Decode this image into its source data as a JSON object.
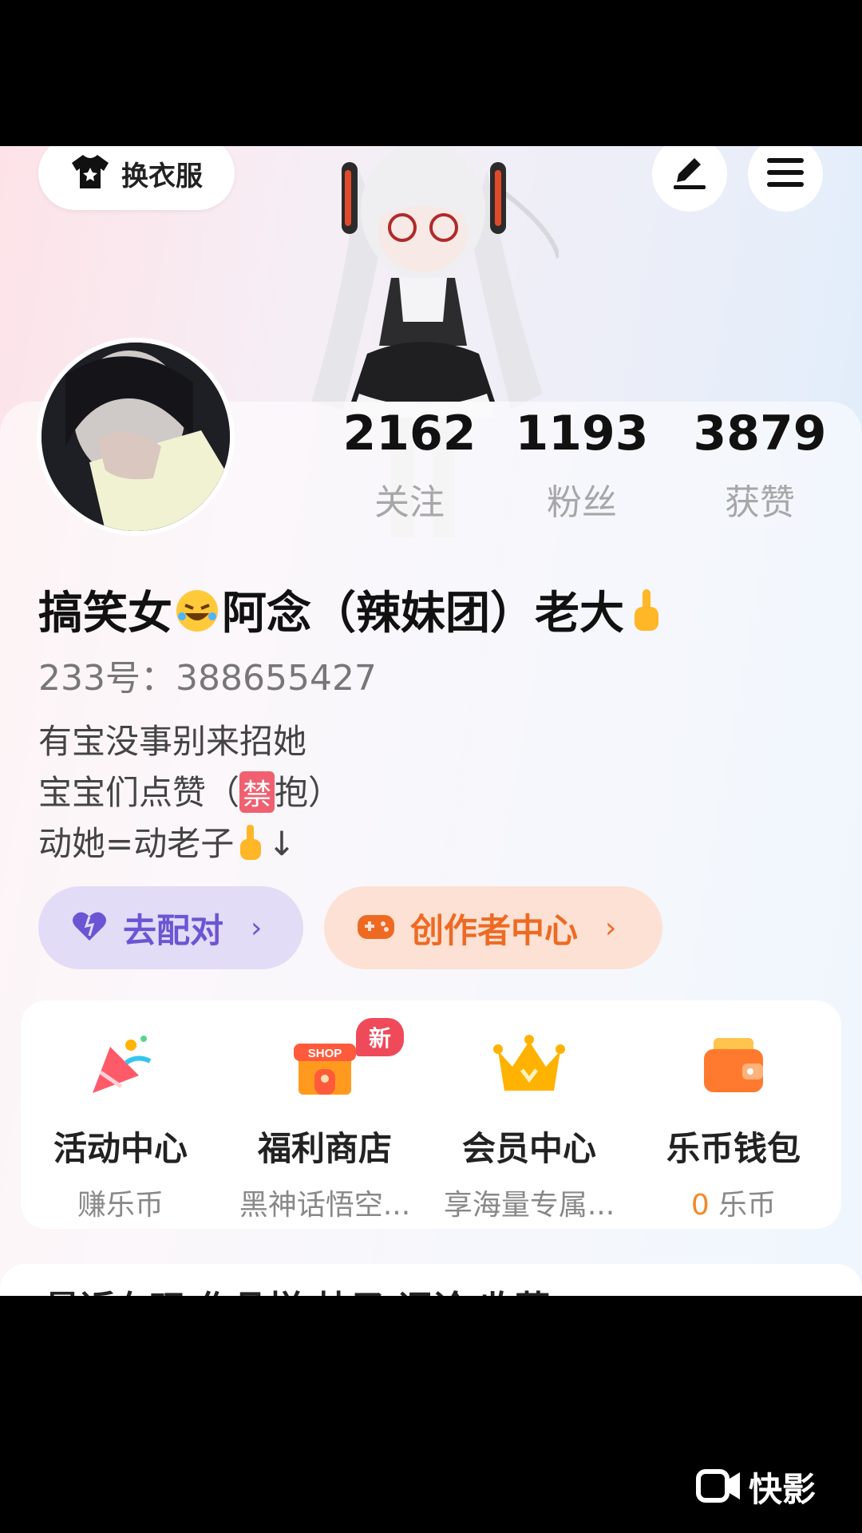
{
  "header": {
    "outfit_label": "换衣服",
    "icons": [
      "shirt-icon",
      "edit-icon",
      "menu-icon"
    ]
  },
  "profile": {
    "stats": [
      {
        "value": "2162",
        "label": "关注"
      },
      {
        "value": "1193",
        "label": "粉丝"
      },
      {
        "value": "3879",
        "label": "获赞"
      }
    ],
    "name_part1": "搞笑女",
    "name_part2": "阿念（辣妹团）老大",
    "id_text": "233号：388655427",
    "bio_line1": "有宝没事别来招她",
    "bio_line2_a": "宝宝们点赞（",
    "bio_line2_ban": "禁",
    "bio_line2_b": "抱）",
    "bio_line3": "动她=动老子",
    "bio_line3_tail": "↓"
  },
  "actions": {
    "match_label": "去配对",
    "creator_label": "创作者中心",
    "chevron": "›"
  },
  "services": [
    {
      "title": "活动中心",
      "sub": "赚乐币",
      "icon": "party-popper-icon"
    },
    {
      "title": "福利商店",
      "sub": "黑神话悟空...",
      "icon": "shop-icon"
    },
    {
      "title": "会员中心",
      "sub": "享海量专属...",
      "icon": "crown-icon"
    },
    {
      "title": "乐币钱包",
      "sub_value": "0",
      "sub_unit": "乐币",
      "icon": "wallet-icon"
    }
  ],
  "shop_badge": "新",
  "shop_sign": "SHOP",
  "tabs_partial": "最近在玩   作品样   帖子   评论   收藏",
  "watermark": "快影",
  "colors": {
    "match": "#6b55d4",
    "creator": "#ee6a23",
    "badge": "#ef4a5a"
  }
}
